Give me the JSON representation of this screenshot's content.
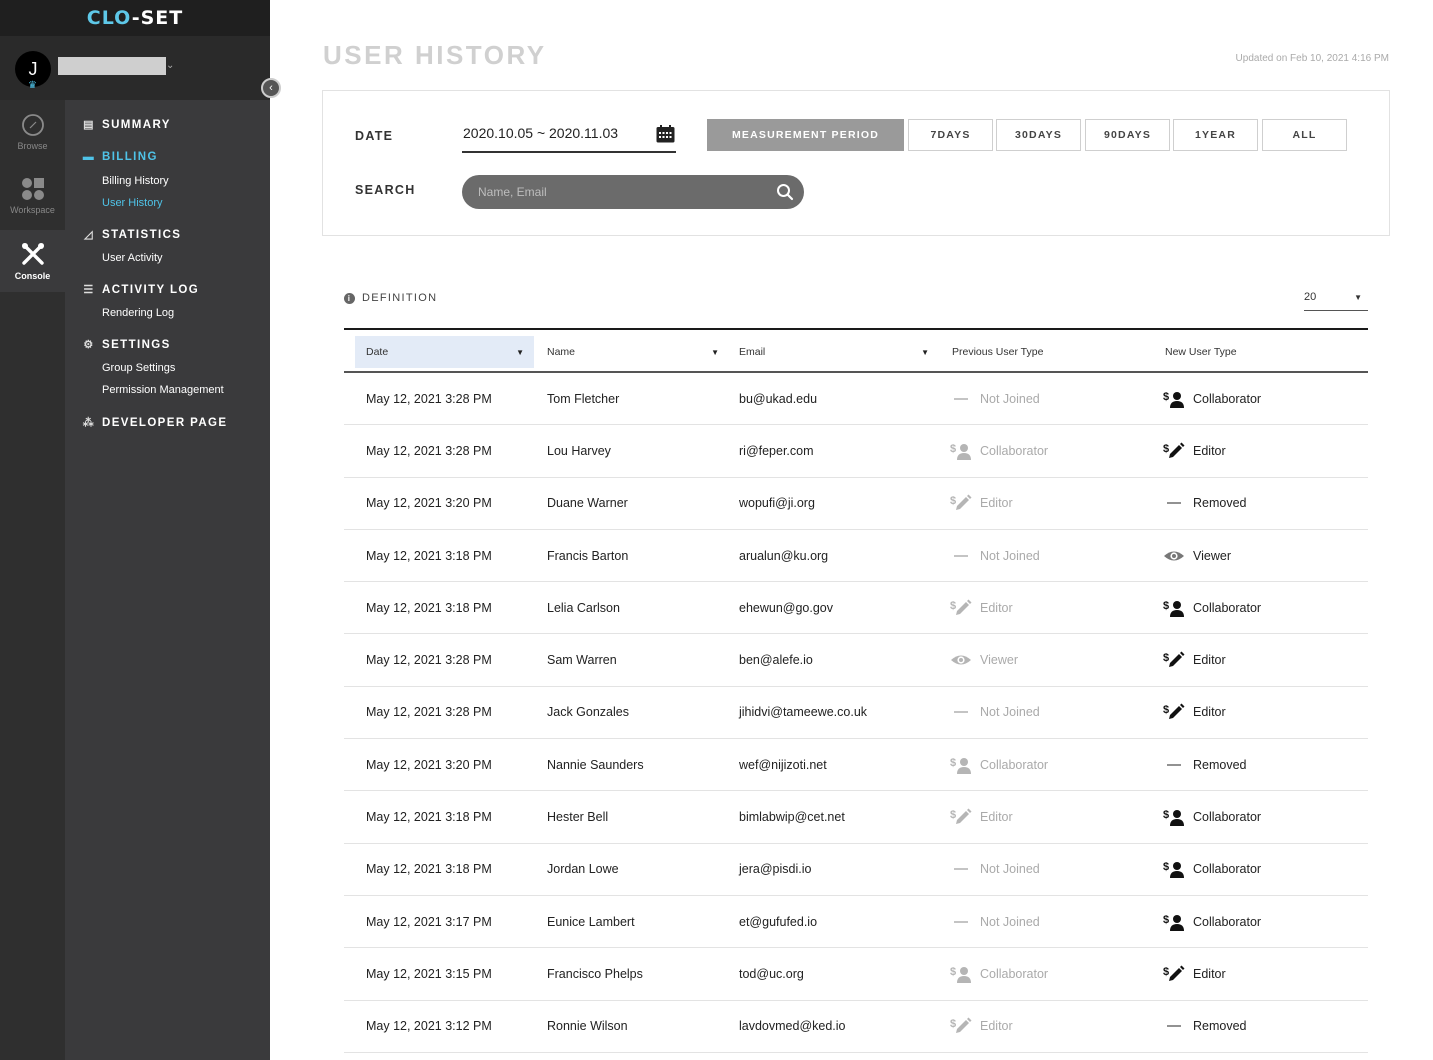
{
  "brand": {
    "logo_left": "CL",
    "logo_mid": "O",
    "logo_right": "-SET",
    "accent": "#4fc3e8"
  },
  "user": {
    "initial": "J"
  },
  "rail": [
    {
      "label": "Browse",
      "icon": "compass-icon"
    },
    {
      "label": "Workspace",
      "icon": "grid-icon"
    },
    {
      "label": "Console",
      "icon": "tools-icon"
    }
  ],
  "menu": {
    "summary": "SUMMARY",
    "billing": "BILLING",
    "billing_history": "Billing History",
    "user_history": "User History",
    "statistics": "STATISTICS",
    "user_activity": "User Activity",
    "activity_log": "ACTIVITY LOG",
    "rendering_log": "Rendering Log",
    "settings": "SETTINGS",
    "group_settings": "Group Settings",
    "permission_management": "Permission Management",
    "developer_page": "DEVELOPER PAGE"
  },
  "page": {
    "title": "USER HISTORY",
    "updated": "Updated on Feb 10, 2021 4:16 PM"
  },
  "filters": {
    "date_label": "DATE",
    "date_value": "2020.10.05 ~ 2020.11.03",
    "search_label": "SEARCH",
    "search_placeholder": "Name, Email",
    "periods": [
      "MEASUREMENT PERIOD",
      "7DAYS",
      "30DAYS",
      "90DAYS",
      "1YEAR",
      "ALL"
    ],
    "active_period": "MEASUREMENT PERIOD"
  },
  "definition_label": "DEFINITION",
  "page_size": "20",
  "table": {
    "headers": {
      "date": "Date",
      "name": "Name",
      "email": "Email",
      "previous": "Previous User Type",
      "new": "New User Type"
    },
    "rows": [
      {
        "date": "May 12, 2021 3:28 PM",
        "name": "Tom Fletcher",
        "email": "bu@ukad.edu",
        "prev": "Not Joined",
        "new": "Collaborator"
      },
      {
        "date": "May 12, 2021 3:28 PM",
        "name": "Lou Harvey",
        "email": "ri@feper.com",
        "prev": "Collaborator",
        "new": "Editor"
      },
      {
        "date": "May 12, 2021 3:20 PM",
        "name": "Duane Warner",
        "email": "wopufi@ji.org",
        "prev": "Editor",
        "new": "Removed"
      },
      {
        "date": "May 12, 2021 3:18 PM",
        "name": "Francis Barton",
        "email": "arualun@ku.org",
        "prev": "Not Joined",
        "new": "Viewer"
      },
      {
        "date": "May 12, 2021 3:18 PM",
        "name": "Lelia Carlson",
        "email": "ehewun@go.gov",
        "prev": "Editor",
        "new": "Collaborator"
      },
      {
        "date": "May 12, 2021 3:28 PM",
        "name": "Sam Warren",
        "email": "ben@alefe.io",
        "prev": "Viewer",
        "new": "Editor"
      },
      {
        "date": "May 12, 2021 3:28 PM",
        "name": "Jack Gonzales",
        "email": "jihidvi@tameewe.co.uk",
        "prev": "Not Joined",
        "new": "Editor"
      },
      {
        "date": "May 12, 2021 3:20 PM",
        "name": "Nannie Saunders",
        "email": "wef@nijizoti.net",
        "prev": "Collaborator",
        "new": "Removed"
      },
      {
        "date": "May 12, 2021 3:18 PM",
        "name": "Hester Bell",
        "email": "bimlabwip@cet.net",
        "prev": "Editor",
        "new": "Collaborator"
      },
      {
        "date": "May 12, 2021 3:18 PM",
        "name": "Jordan Lowe",
        "email": "jera@pisdi.io",
        "prev": "Not Joined",
        "new": "Collaborator"
      },
      {
        "date": "May 12, 2021 3:17 PM",
        "name": "Eunice Lambert",
        "email": "et@gufufed.io",
        "prev": "Not Joined",
        "new": "Collaborator"
      },
      {
        "date": "May 12, 2021 3:15 PM",
        "name": "Francisco Phelps",
        "email": "tod@uc.org",
        "prev": "Collaborator",
        "new": "Editor"
      },
      {
        "date": "May 12, 2021 3:12 PM",
        "name": "Ronnie Wilson",
        "email": "lavdovmed@ked.io",
        "prev": "Editor",
        "new": "Removed"
      }
    ]
  }
}
